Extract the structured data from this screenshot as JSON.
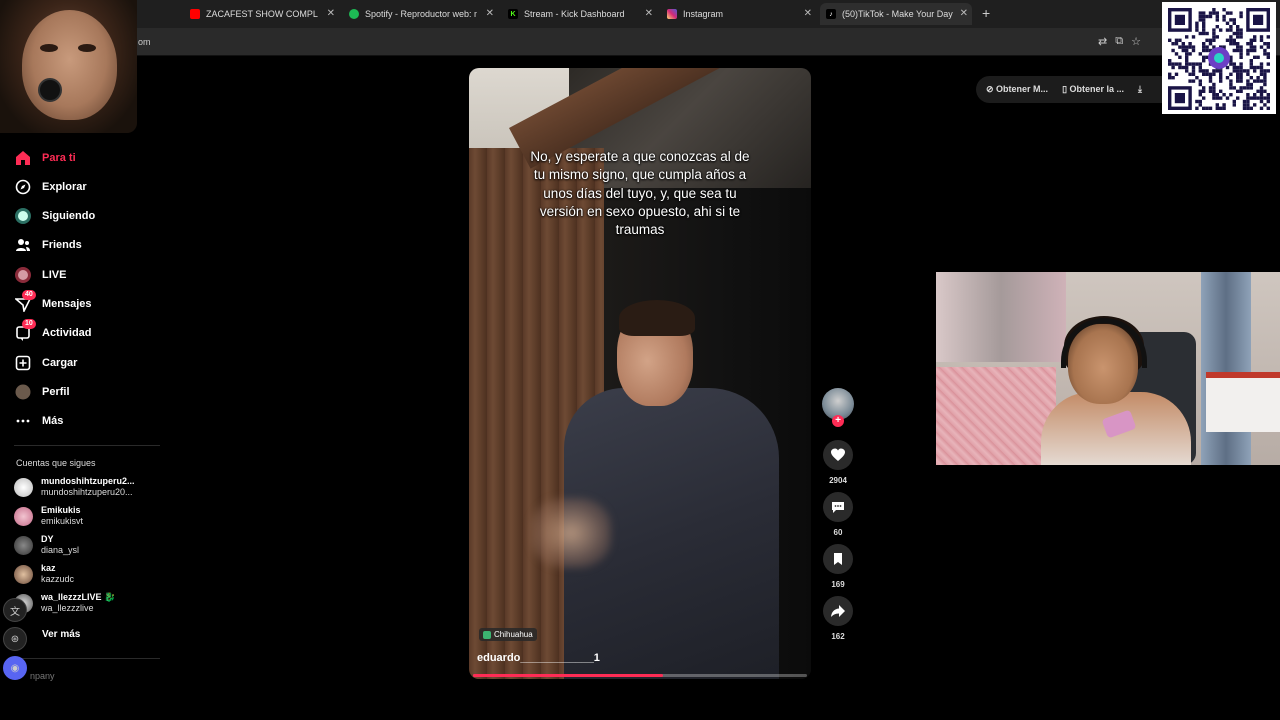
{
  "tabs": [
    {
      "title": "ZACAFEST SHOW COMPLETO -",
      "favicon": "youtube-icon",
      "color": "#ff0000"
    },
    {
      "title": "Spotify - Reproductor web: mú",
      "favicon": "spotify-icon",
      "color": "#1db954"
    },
    {
      "title": "Stream - Kick Dashboard",
      "favicon": "kick-icon",
      "color": "#53fc18"
    },
    {
      "title": "Instagram",
      "favicon": "instagram-icon",
      "color": "#e1306c"
    },
    {
      "title": "(50)TikTok - Make Your Day",
      "favicon": "tiktok-icon",
      "color": "#ffffff",
      "active": true
    }
  ],
  "address": {
    "visible_text": "om"
  },
  "sidebar": {
    "nav": [
      {
        "label": "Para ti",
        "icon": "home-icon",
        "active": true
      },
      {
        "label": "Explorar",
        "icon": "compass-icon"
      },
      {
        "label": "Siguiendo",
        "icon": "following-icon"
      },
      {
        "label": "Friends",
        "icon": "friends-icon"
      },
      {
        "label": "LIVE",
        "icon": "live-icon"
      },
      {
        "label": "Mensajes",
        "icon": "messages-icon",
        "badge": "40"
      },
      {
        "label": "Actividad",
        "icon": "activity-icon",
        "badge": "10"
      },
      {
        "label": "Cargar",
        "icon": "upload-icon"
      },
      {
        "label": "Perfil",
        "icon": "profile-icon"
      },
      {
        "label": "Más",
        "icon": "more-icon"
      }
    ],
    "following_header": "Cuentas que sigues",
    "following": [
      {
        "name": "mundoshihtzuperu2...",
        "handle": "mundoshihtzuperu20..."
      },
      {
        "name": "Emikukis",
        "handle": "emikukisvt"
      },
      {
        "name": "DY",
        "handle": "diana_ysl"
      },
      {
        "name": "kaz",
        "handle": "kazzudc"
      },
      {
        "name": "wa_llezzzLIVE 🐉",
        "handle": "wa_llezzzlive"
      }
    ],
    "see_more": "Ver más",
    "company": "npany"
  },
  "video": {
    "caption": "No, y esperate a que conozcas al de tu mismo signo, que cumpla años a unos días del tuyo, y, que sea tu versión en sexo opuesto, ahi si te traumas",
    "location": "Chihuahua",
    "author": "eduardo____________1",
    "progress": 0.57
  },
  "actions": {
    "likes": "2904",
    "comments": "60",
    "saves": "169",
    "shares": "162"
  },
  "top_buttons": [
    "Obtener M...",
    "Obtener la ..."
  ],
  "colors": {
    "accent": "#fe2c55",
    "background": "#000000"
  }
}
